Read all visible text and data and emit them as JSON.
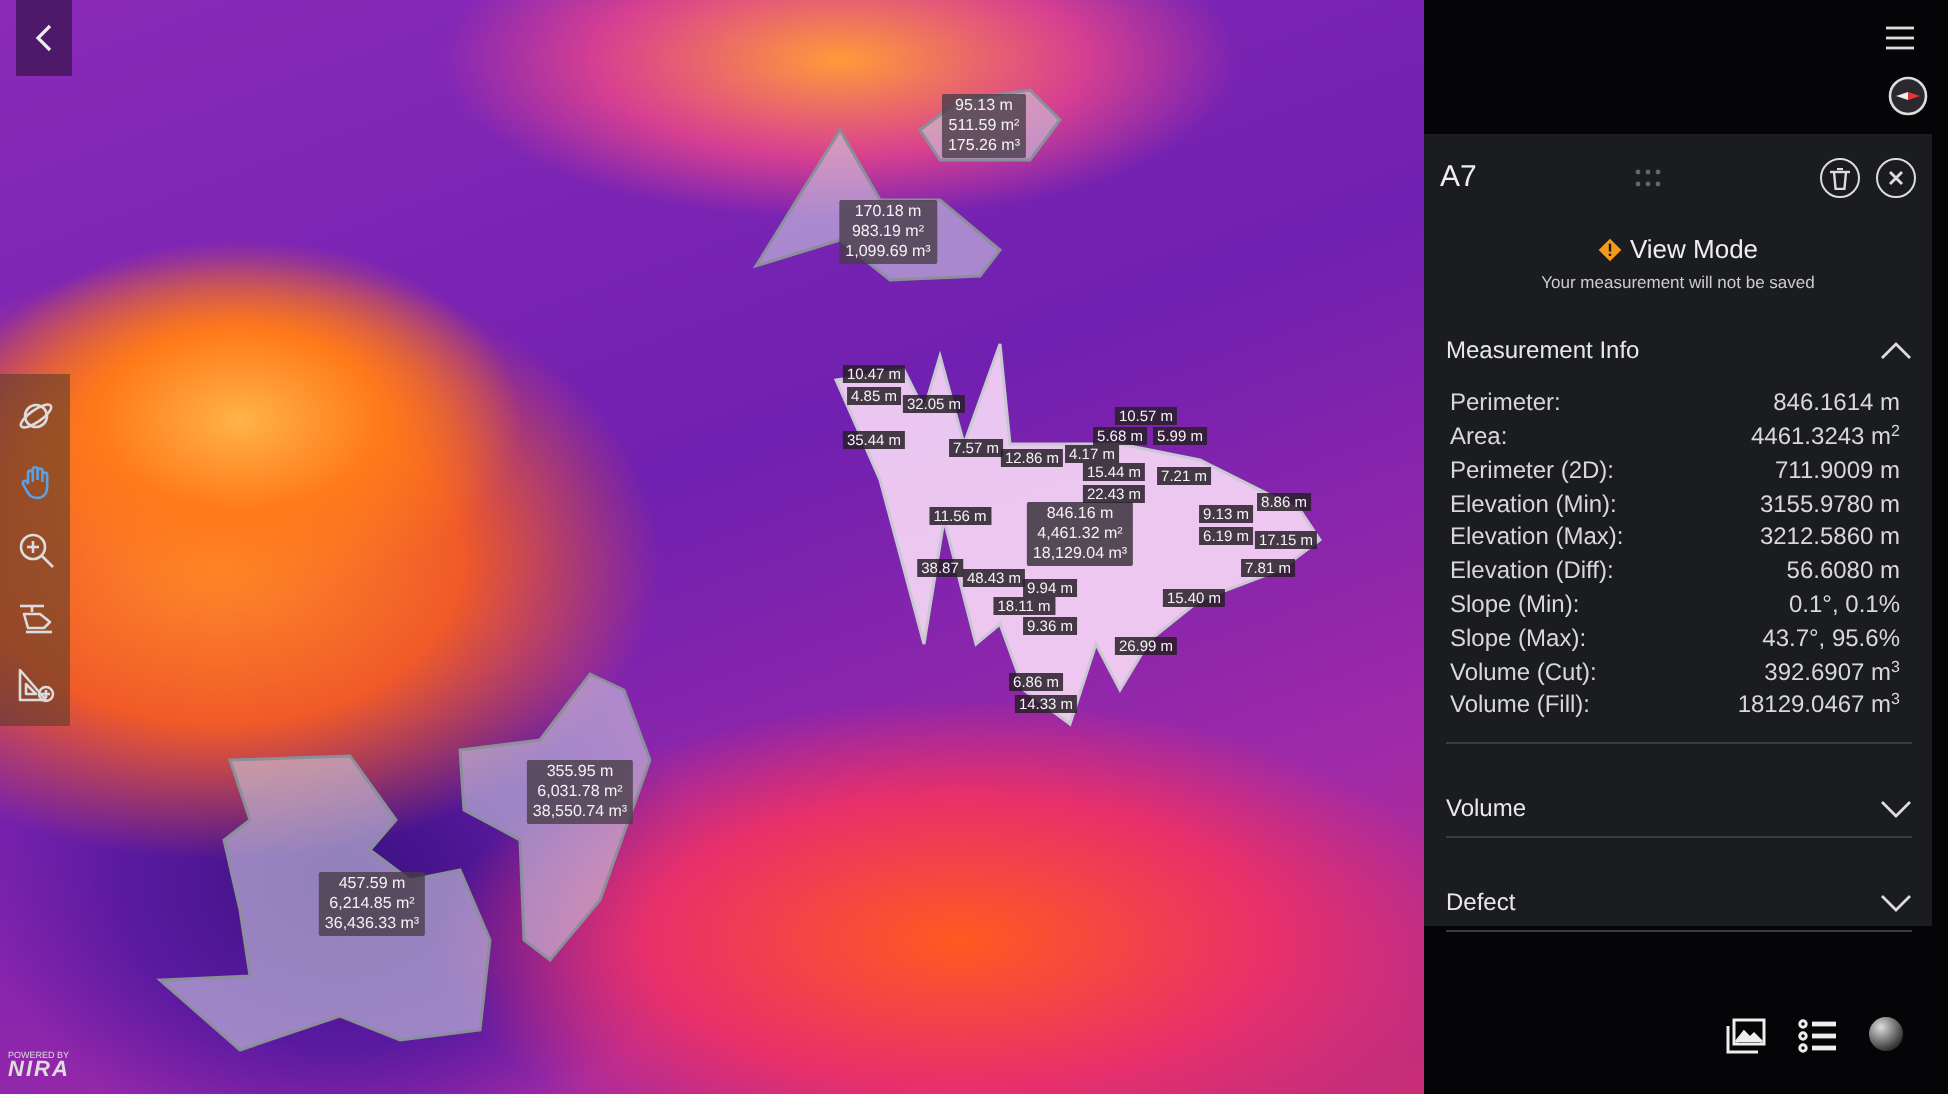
{
  "tools": [
    {
      "kind": "orbit",
      "selected": false
    },
    {
      "kind": "pan",
      "selected": true
    },
    {
      "kind": "zoom",
      "selected": false
    },
    {
      "kind": "drone",
      "selected": false
    },
    {
      "kind": "measure",
      "selected": false
    }
  ],
  "measurements": [
    {
      "selected": false,
      "lines": [
        "95.13 m",
        "511.59 m²",
        "175.26 m³"
      ]
    },
    {
      "selected": false,
      "lines": [
        "170.18 m",
        "983.19 m²",
        "1,099.69 m³"
      ]
    },
    {
      "selected": true,
      "lines": [
        "846.16 m",
        "4,461.32 m²",
        "18,129.04 m³"
      ]
    },
    {
      "selected": false,
      "lines": [
        "355.95 m",
        "6,031.78 m²",
        "38,550.74 m³"
      ]
    },
    {
      "selected": false,
      "lines": [
        "457.59 m",
        "6,214.85 m²",
        "36,436.33 m³"
      ]
    }
  ],
  "segment_labels": [
    "10.47 m",
    "4.85 m",
    "32.05 m",
    "35.44 m",
    "7.57 m",
    "12.86 m",
    "4.17 m",
    "10.57 m",
    "5.68 m",
    "5.99 m",
    "15.44 m",
    "22.43 m",
    "7.21 m",
    "8.86 m",
    "9.13 m",
    "6.19 m",
    "17.15 m",
    "11.56 m",
    "38.87",
    "48.43 m",
    "9.94 m",
    "18.11 m",
    "9.36 m",
    "26.99 m",
    "15.40 m",
    "7.81 m",
    "6.86 m",
    "14.33 m"
  ],
  "panel": {
    "title": "A7",
    "mode": {
      "title": "View Mode",
      "note": "Your measurement will not be saved"
    },
    "sections": [
      {
        "title": "Measurement Info",
        "expanded": true,
        "rows": [
          {
            "label": "Perimeter:",
            "value": "846.1614 m"
          },
          {
            "label": "Area:",
            "value": "4461.3243 m$^{2}$"
          },
          {
            "label": "Perimeter (2D):",
            "value": "711.9009 m"
          },
          {
            "label": "Elevation (Min):",
            "value": "3155.9780 m"
          },
          {
            "label": "Elevation (Max):",
            "value": "3212.5860 m"
          },
          {
            "label": "Elevation (Diff):",
            "value": "56.6080 m"
          },
          {
            "label": "Slope (Min):",
            "value": "0.1°, 0.1%"
          },
          {
            "label": "Slope (Max):",
            "value": "43.7°, 95.6%"
          },
          {
            "label": "Volume (Cut):",
            "value": "392.6907 m$^{3}$"
          },
          {
            "label": "Volume (Fill):",
            "value": "18129.0467 m$^{3}$"
          }
        ]
      },
      {
        "title": "Volume",
        "expanded": false
      },
      {
        "title": "Defect",
        "expanded": false
      }
    ]
  },
  "branding": {
    "caption": "POWERED BY",
    "name": "NIRA"
  }
}
